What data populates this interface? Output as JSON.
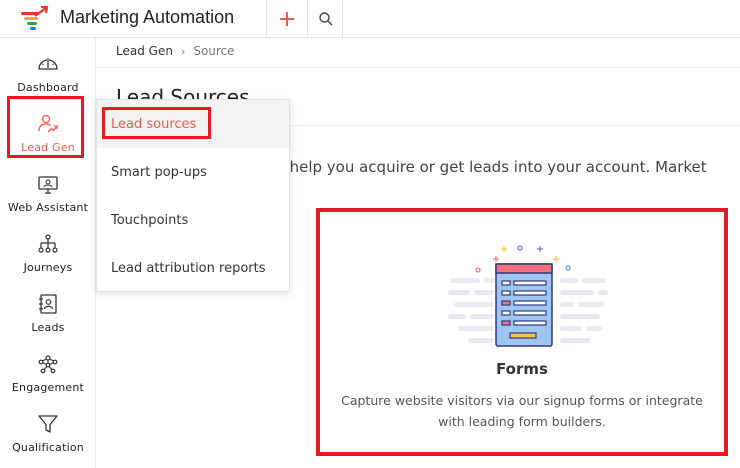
{
  "app": {
    "title": "Marketing Automation"
  },
  "toolbar": {
    "add_icon": "plus-icon",
    "search_icon": "search-icon"
  },
  "sidebar": {
    "items": [
      {
        "label": "Dashboard",
        "icon": "speedometer-icon"
      },
      {
        "label": "Lead Gen",
        "icon": "lead-gen-icon",
        "active": true
      },
      {
        "label": "Web Assistant",
        "icon": "monitor-icon"
      },
      {
        "label": "Journeys",
        "icon": "journey-icon"
      },
      {
        "label": "Leads",
        "icon": "contact-book-icon"
      },
      {
        "label": "Engagement",
        "icon": "network-icon"
      },
      {
        "label": "Qualification",
        "icon": "funnel-icon"
      }
    ]
  },
  "breadcrumb": {
    "parent": "Lead Gen",
    "current": "Source"
  },
  "page": {
    "title": "Lead Sources",
    "description": "s help you acquire or get leads into your account. Market"
  },
  "dropdown": {
    "items": [
      {
        "label": "Lead sources",
        "active": true
      },
      {
        "label": "Smart pop-ups"
      },
      {
        "label": "Touchpoints"
      },
      {
        "label": "Lead attribution reports"
      }
    ]
  },
  "card": {
    "title": "Forms",
    "description": "Capture website visitors via our signup forms or integrate with leading form builders.",
    "icon": "form-illustration"
  },
  "colors": {
    "accent": "#ef5a4b",
    "highlight_box": "#e41b23"
  }
}
